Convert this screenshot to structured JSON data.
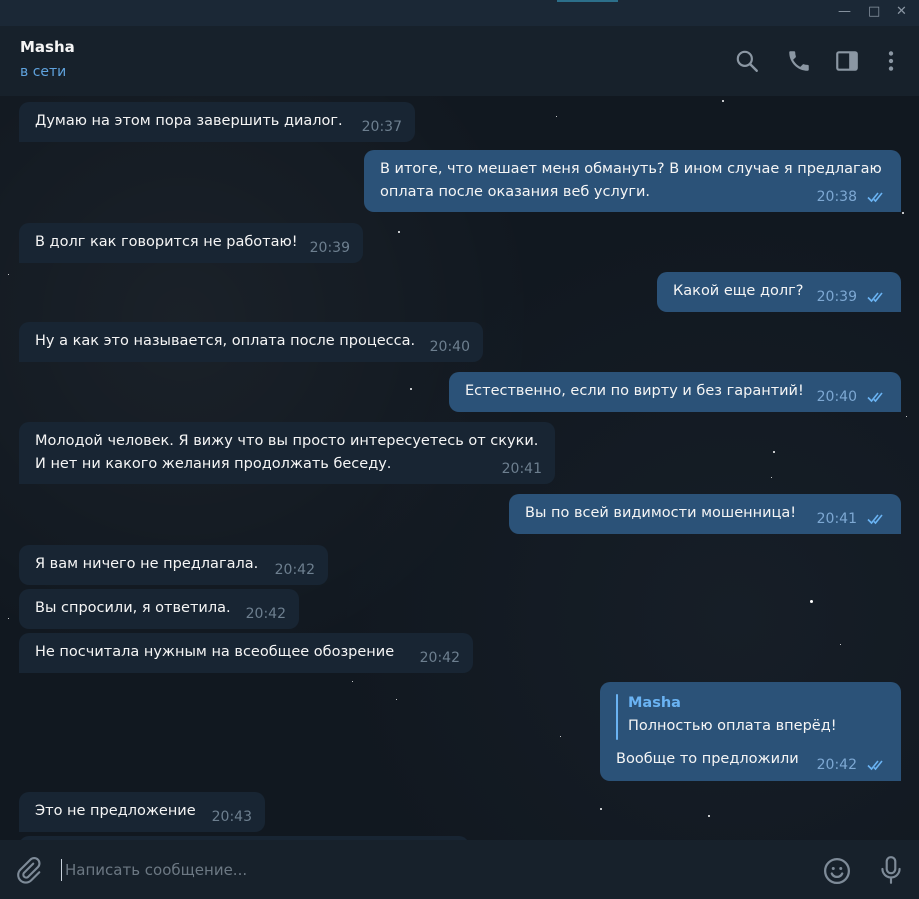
{
  "window": {
    "minimize_glyph": "—",
    "maximize_glyph": "□",
    "close_glyph": "✕"
  },
  "header": {
    "contact_name": "Masha",
    "status": "в сети",
    "icons": [
      "search-icon",
      "phone-icon",
      "sidebar-toggle-icon",
      "more-vertical-icon"
    ]
  },
  "messages": [
    {
      "dir": "in",
      "text": "Думаю на этом пора завершить диалог.",
      "time": "20:37"
    },
    {
      "dir": "out",
      "text": "В итоге, что мешает меня обмануть? В ином случае я предлагаю\nоплата после оказания веб услуги.",
      "time": "20:38",
      "read": true
    },
    {
      "dir": "in",
      "text": "В долг как говорится не работаю!",
      "time": "20:39"
    },
    {
      "dir": "out",
      "text": "Какой еще долг?",
      "time": "20:39",
      "read": true
    },
    {
      "dir": "in",
      "text": "Ну а как это называется, оплата после процесса.",
      "time": "20:40"
    },
    {
      "dir": "out",
      "text": "Естественно, если по вирту и без гарантий!",
      "time": "20:40",
      "read": true
    },
    {
      "dir": "in",
      "text": "Молодой человек. Я вижу что вы просто интересуетесь от скуки.\nИ нет ни какого желания продолжать беседу.",
      "time": "20:41"
    },
    {
      "dir": "out",
      "text": "Вы по всей видимости мошенница!",
      "time": "20:41",
      "read": true
    },
    {
      "dir": "in",
      "text": "Я вам ничего не предлагала.",
      "time": "20:42"
    },
    {
      "dir": "in",
      "text": "Вы спросили, я ответила.",
      "time": "20:42"
    },
    {
      "dir": "in",
      "text": "Не посчитала нужным на всеобщее обозрение",
      "time": "20:42"
    },
    {
      "dir": "out",
      "reply_to_name": "Masha",
      "reply_to_text": "Полностью оплата вперёд!",
      "text": "Вообще то предложили",
      "time": "20:42",
      "read": true
    },
    {
      "dir": "in",
      "text": "Это не предложение",
      "time": "20:43"
    }
  ],
  "composer": {
    "placeholder": "Написать сообщение...",
    "value": "",
    "icons": [
      "attach-icon",
      "emoji-icon",
      "microphone-icon"
    ]
  },
  "colors": {
    "background": "#0e1621",
    "header_bg": "#17212b",
    "incoming_bubble": "#182533",
    "outgoing_bubble": "#2b5278",
    "accent": "#5fa2dd",
    "read_check": "#6ab3f3"
  }
}
